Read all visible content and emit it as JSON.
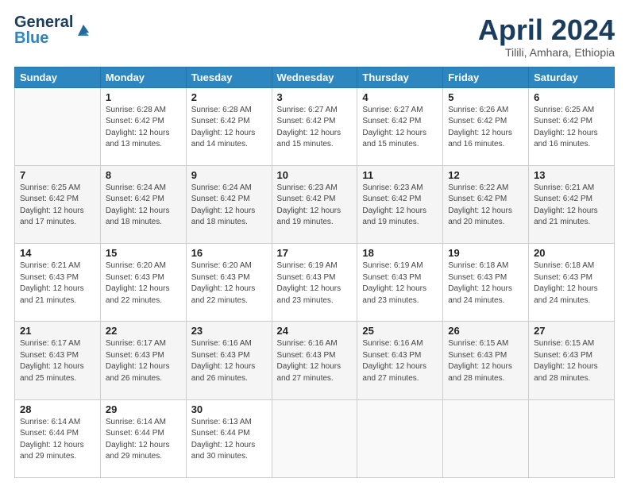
{
  "logo": {
    "line1": "General",
    "line2": "Blue"
  },
  "header": {
    "month": "April 2024",
    "location": "Tilili, Amhara, Ethiopia"
  },
  "weekdays": [
    "Sunday",
    "Monday",
    "Tuesday",
    "Wednesday",
    "Thursday",
    "Friday",
    "Saturday"
  ],
  "weeks": [
    [
      {
        "day": "",
        "info": ""
      },
      {
        "day": "1",
        "info": "Sunrise: 6:28 AM\nSunset: 6:42 PM\nDaylight: 12 hours\nand 13 minutes."
      },
      {
        "day": "2",
        "info": "Sunrise: 6:28 AM\nSunset: 6:42 PM\nDaylight: 12 hours\nand 14 minutes."
      },
      {
        "day": "3",
        "info": "Sunrise: 6:27 AM\nSunset: 6:42 PM\nDaylight: 12 hours\nand 15 minutes."
      },
      {
        "day": "4",
        "info": "Sunrise: 6:27 AM\nSunset: 6:42 PM\nDaylight: 12 hours\nand 15 minutes."
      },
      {
        "day": "5",
        "info": "Sunrise: 6:26 AM\nSunset: 6:42 PM\nDaylight: 12 hours\nand 16 minutes."
      },
      {
        "day": "6",
        "info": "Sunrise: 6:25 AM\nSunset: 6:42 PM\nDaylight: 12 hours\nand 16 minutes."
      }
    ],
    [
      {
        "day": "7",
        "info": "Sunrise: 6:25 AM\nSunset: 6:42 PM\nDaylight: 12 hours\nand 17 minutes."
      },
      {
        "day": "8",
        "info": "Sunrise: 6:24 AM\nSunset: 6:42 PM\nDaylight: 12 hours\nand 18 minutes."
      },
      {
        "day": "9",
        "info": "Sunrise: 6:24 AM\nSunset: 6:42 PM\nDaylight: 12 hours\nand 18 minutes."
      },
      {
        "day": "10",
        "info": "Sunrise: 6:23 AM\nSunset: 6:42 PM\nDaylight: 12 hours\nand 19 minutes."
      },
      {
        "day": "11",
        "info": "Sunrise: 6:23 AM\nSunset: 6:42 PM\nDaylight: 12 hours\nand 19 minutes."
      },
      {
        "day": "12",
        "info": "Sunrise: 6:22 AM\nSunset: 6:42 PM\nDaylight: 12 hours\nand 20 minutes."
      },
      {
        "day": "13",
        "info": "Sunrise: 6:21 AM\nSunset: 6:42 PM\nDaylight: 12 hours\nand 21 minutes."
      }
    ],
    [
      {
        "day": "14",
        "info": "Sunrise: 6:21 AM\nSunset: 6:43 PM\nDaylight: 12 hours\nand 21 minutes."
      },
      {
        "day": "15",
        "info": "Sunrise: 6:20 AM\nSunset: 6:43 PM\nDaylight: 12 hours\nand 22 minutes."
      },
      {
        "day": "16",
        "info": "Sunrise: 6:20 AM\nSunset: 6:43 PM\nDaylight: 12 hours\nand 22 minutes."
      },
      {
        "day": "17",
        "info": "Sunrise: 6:19 AM\nSunset: 6:43 PM\nDaylight: 12 hours\nand 23 minutes."
      },
      {
        "day": "18",
        "info": "Sunrise: 6:19 AM\nSunset: 6:43 PM\nDaylight: 12 hours\nand 23 minutes."
      },
      {
        "day": "19",
        "info": "Sunrise: 6:18 AM\nSunset: 6:43 PM\nDaylight: 12 hours\nand 24 minutes."
      },
      {
        "day": "20",
        "info": "Sunrise: 6:18 AM\nSunset: 6:43 PM\nDaylight: 12 hours\nand 24 minutes."
      }
    ],
    [
      {
        "day": "21",
        "info": "Sunrise: 6:17 AM\nSunset: 6:43 PM\nDaylight: 12 hours\nand 25 minutes."
      },
      {
        "day": "22",
        "info": "Sunrise: 6:17 AM\nSunset: 6:43 PM\nDaylight: 12 hours\nand 26 minutes."
      },
      {
        "day": "23",
        "info": "Sunrise: 6:16 AM\nSunset: 6:43 PM\nDaylight: 12 hours\nand 26 minutes."
      },
      {
        "day": "24",
        "info": "Sunrise: 6:16 AM\nSunset: 6:43 PM\nDaylight: 12 hours\nand 27 minutes."
      },
      {
        "day": "25",
        "info": "Sunrise: 6:16 AM\nSunset: 6:43 PM\nDaylight: 12 hours\nand 27 minutes."
      },
      {
        "day": "26",
        "info": "Sunrise: 6:15 AM\nSunset: 6:43 PM\nDaylight: 12 hours\nand 28 minutes."
      },
      {
        "day": "27",
        "info": "Sunrise: 6:15 AM\nSunset: 6:43 PM\nDaylight: 12 hours\nand 28 minutes."
      }
    ],
    [
      {
        "day": "28",
        "info": "Sunrise: 6:14 AM\nSunset: 6:44 PM\nDaylight: 12 hours\nand 29 minutes."
      },
      {
        "day": "29",
        "info": "Sunrise: 6:14 AM\nSunset: 6:44 PM\nDaylight: 12 hours\nand 29 minutes."
      },
      {
        "day": "30",
        "info": "Sunrise: 6:13 AM\nSunset: 6:44 PM\nDaylight: 12 hours\nand 30 minutes."
      },
      {
        "day": "",
        "info": ""
      },
      {
        "day": "",
        "info": ""
      },
      {
        "day": "",
        "info": ""
      },
      {
        "day": "",
        "info": ""
      }
    ]
  ]
}
